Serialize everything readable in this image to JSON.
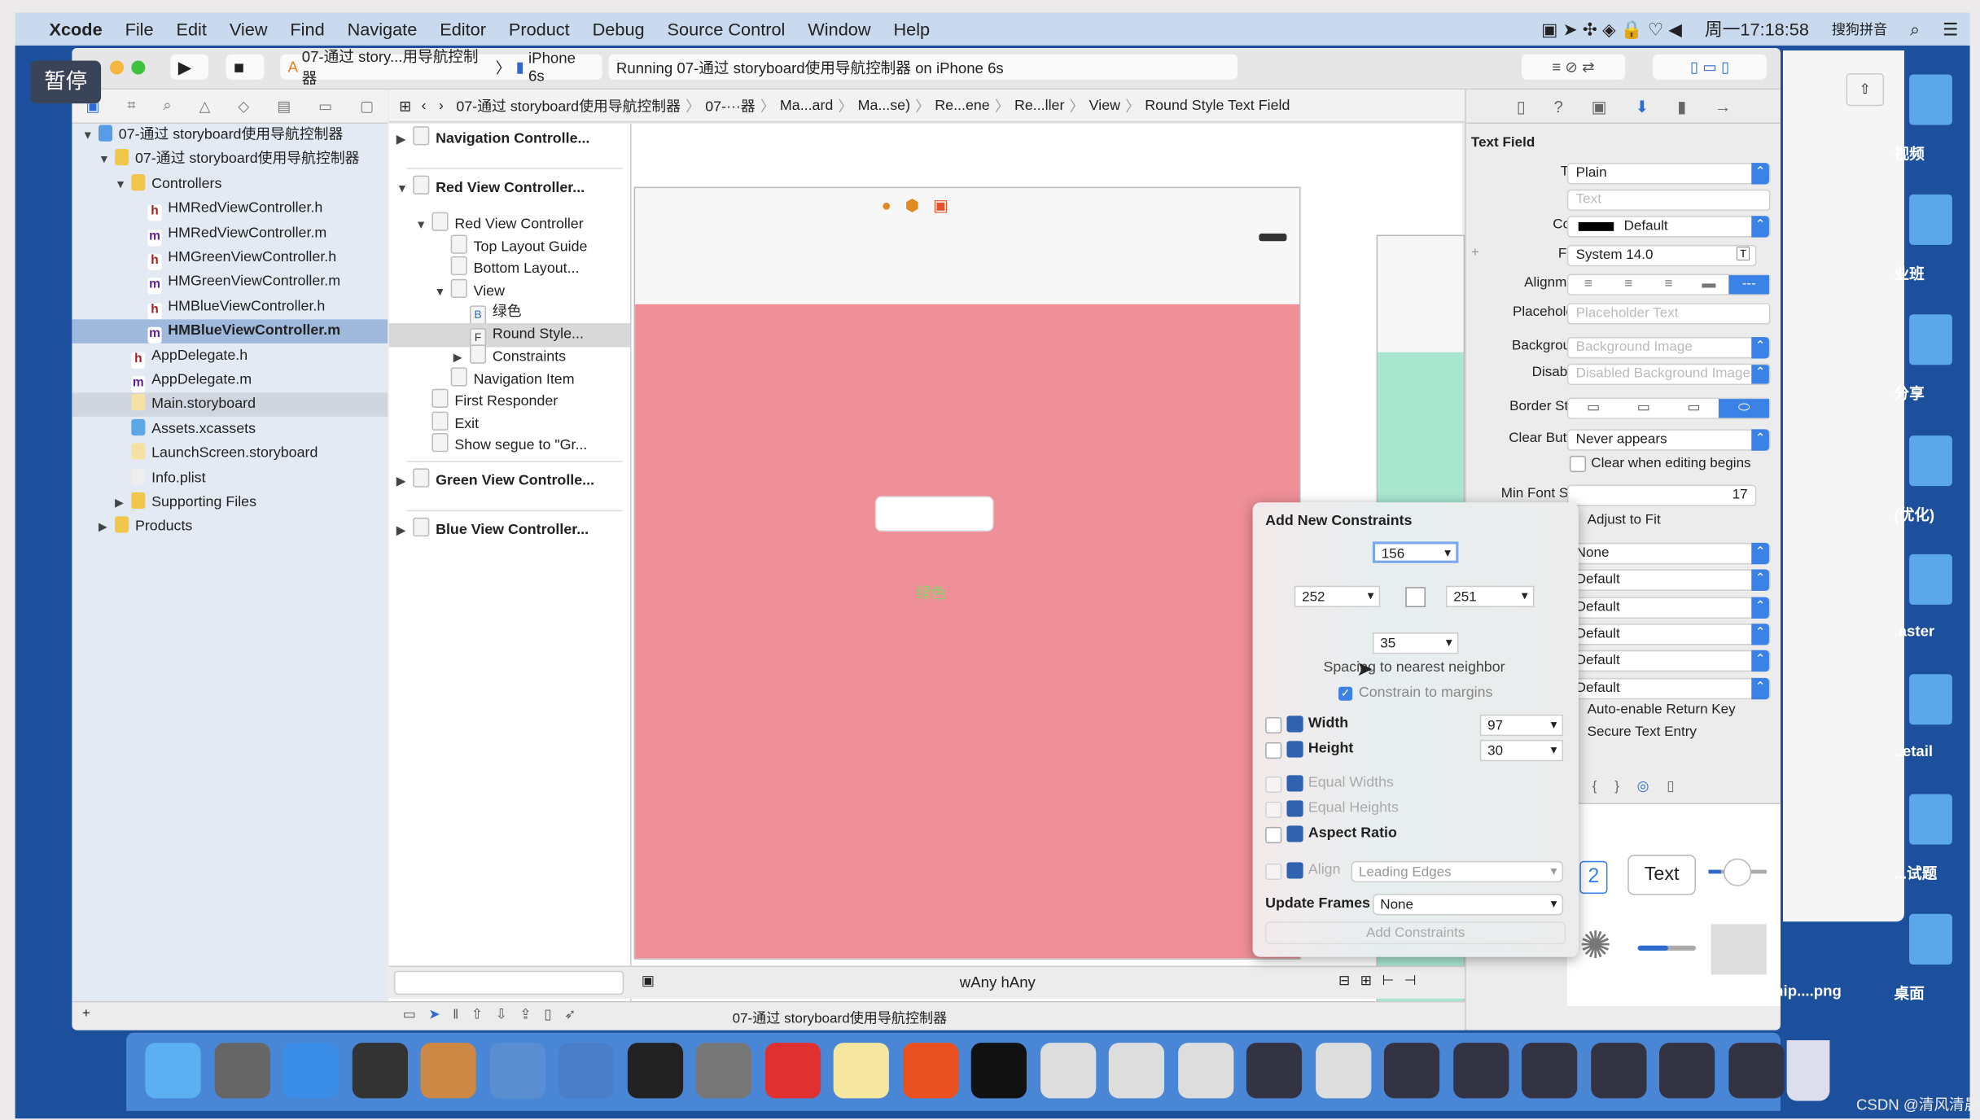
{
  "menubar": {
    "app": "Xcode",
    "items": [
      "File",
      "Edit",
      "View",
      "Find",
      "Navigate",
      "Editor",
      "Product",
      "Debug",
      "Source Control",
      "Window",
      "Help"
    ],
    "clock": "周一17:18:58",
    "ime": "搜狗拼音"
  },
  "overlay": {
    "pause": "暂停"
  },
  "toolbar": {
    "scheme": "07-通过 story...用导航控制器",
    "device": "iPhone 6s",
    "status": "Running 07-通过 storyboard使用导航控制器 on iPhone 6s"
  },
  "jumpbar": [
    "07-通过 storyboard使用导航控制器",
    "07-···器",
    "Ma...ard",
    "Ma...se)",
    "Re...ene",
    "Re...ller",
    "View",
    "Round Style Text Field"
  ],
  "file_nav": [
    {
      "label": "07-通过 storyboard使用导航控制器",
      "level": 0,
      "icon": "project-icon",
      "disclosure": "open"
    },
    {
      "label": "07-通过 storyboard使用导航控制器",
      "level": 1,
      "icon": "folder-icon",
      "disclosure": "open"
    },
    {
      "label": "Controllers",
      "level": 2,
      "icon": "folder-icon",
      "disclosure": "open"
    },
    {
      "label": "HMRedViewController.h",
      "level": 3,
      "icon": "h-file-icon"
    },
    {
      "label": "HMRedViewController.m",
      "level": 3,
      "icon": "m-file-icon"
    },
    {
      "label": "HMGreenViewController.h",
      "level": 3,
      "icon": "h-file-icon"
    },
    {
      "label": "HMGreenViewController.m",
      "level": 3,
      "icon": "m-file-icon"
    },
    {
      "label": "HMBlueViewController.h",
      "level": 3,
      "icon": "h-file-icon"
    },
    {
      "label": "HMBlueViewController.m",
      "level": 3,
      "icon": "m-file-icon",
      "selected": true
    },
    {
      "label": "AppDelegate.h",
      "level": 2,
      "icon": "h-file-icon"
    },
    {
      "label": "AppDelegate.m",
      "level": 2,
      "icon": "m-file-icon"
    },
    {
      "label": "Main.storyboard",
      "level": 2,
      "icon": "storyboard-icon",
      "highlighted": true
    },
    {
      "label": "Assets.xcassets",
      "level": 2,
      "icon": "assets-icon"
    },
    {
      "label": "LaunchScreen.storyboard",
      "level": 2,
      "icon": "storyboard-icon"
    },
    {
      "label": "Info.plist",
      "level": 2,
      "icon": "plist-icon"
    },
    {
      "label": "Supporting Files",
      "level": 2,
      "icon": "folder-icon",
      "disclosure": "closed"
    },
    {
      "label": "Products",
      "level": 1,
      "icon": "folder-icon",
      "disclosure": "closed"
    }
  ],
  "outline": [
    {
      "label": "Navigation Controlle...",
      "level": 0,
      "bold": true,
      "disclosure": "closed"
    },
    {
      "label": "Red View Controller...",
      "level": 0,
      "bold": true,
      "disclosure": "open"
    },
    {
      "label": "Red View Controller",
      "level": 1,
      "disclosure": "open"
    },
    {
      "label": "Top Layout Guide",
      "level": 2
    },
    {
      "label": "Bottom Layout...",
      "level": 2
    },
    {
      "label": "View",
      "level": 2,
      "disclosure": "open"
    },
    {
      "label": "绿色",
      "level": 3,
      "badge": "B"
    },
    {
      "label": "Round Style...",
      "level": 3,
      "badge": "F",
      "selected": true
    },
    {
      "label": "Constraints",
      "level": 3,
      "disclosure": "closed"
    },
    {
      "label": "Navigation Item",
      "level": 2
    },
    {
      "label": "First Responder",
      "level": 1
    },
    {
      "label": "Exit",
      "level": 1
    },
    {
      "label": "Show segue to \"Gr...",
      "level": 1
    },
    {
      "label": "Green View Controlle...",
      "level": 0,
      "bold": true,
      "disclosure": "closed"
    },
    {
      "label": "Blue View Controller...",
      "level": 0,
      "bold": true,
      "disclosure": "closed"
    }
  ],
  "canvas": {
    "button_label": "绿色",
    "size_class": "wAny hAny",
    "colors": {
      "red_view": "#ef8f98",
      "green_view": "#a8e6d0"
    }
  },
  "inspector": {
    "section": "Text Field",
    "text_label": "Text",
    "text_value": "Plain",
    "text_placeholder": "Text",
    "color_label": "Color",
    "color_value": "Default",
    "font_label": "Font",
    "font_value": "System 14.0",
    "alignment_label": "Alignment",
    "placeholder_label": "Placeholder",
    "placeholder_placeholder": "Placeholder Text",
    "background_label": "Background",
    "background_placeholder": "Background Image",
    "disabled_label": "Disabled",
    "disabled_placeholder": "Disabled Background Image",
    "border_label": "Border Style",
    "clear_label": "Clear Button",
    "clear_value": "Never appears",
    "clear_editing": "Clear when editing begins",
    "min_font_label": "Min Font Size",
    "min_font_value": "17",
    "adjust": "Adjust to Fit",
    "selects": [
      "None",
      "Default",
      "Default",
      "Default",
      "Default",
      "Default"
    ],
    "auto_return": "Auto-enable Return Key",
    "secure": "Secure Text Entry",
    "library_text": "Text",
    "library_num": "2"
  },
  "constraints": {
    "title": "Add New Constraints",
    "top": "156",
    "left": "252",
    "right": "251",
    "bottom": "35",
    "spacing_label": "Spacing to nearest neighbor",
    "margins": "Constrain to margins",
    "width_label": "Width",
    "width_value": "97",
    "height_label": "Height",
    "height_value": "30",
    "equal_widths": "Equal Widths",
    "equal_heights": "Equal Heights",
    "aspect": "Aspect Ratio",
    "align_label": "Align",
    "align_value": "Leading Edges",
    "update_label": "Update Frames",
    "update_value": "None",
    "add_button": "Add Constraints"
  },
  "debugbar": {
    "target": "07-通过 storyboard使用导航控制器"
  },
  "desktop": [
    "视频",
    "业班",
    "分享",
    "(优化)",
    ".aster",
    "..etail",
    "...试题",
    "nip....png",
    "桌面"
  ],
  "watermark": "CSDN @清风清晨"
}
